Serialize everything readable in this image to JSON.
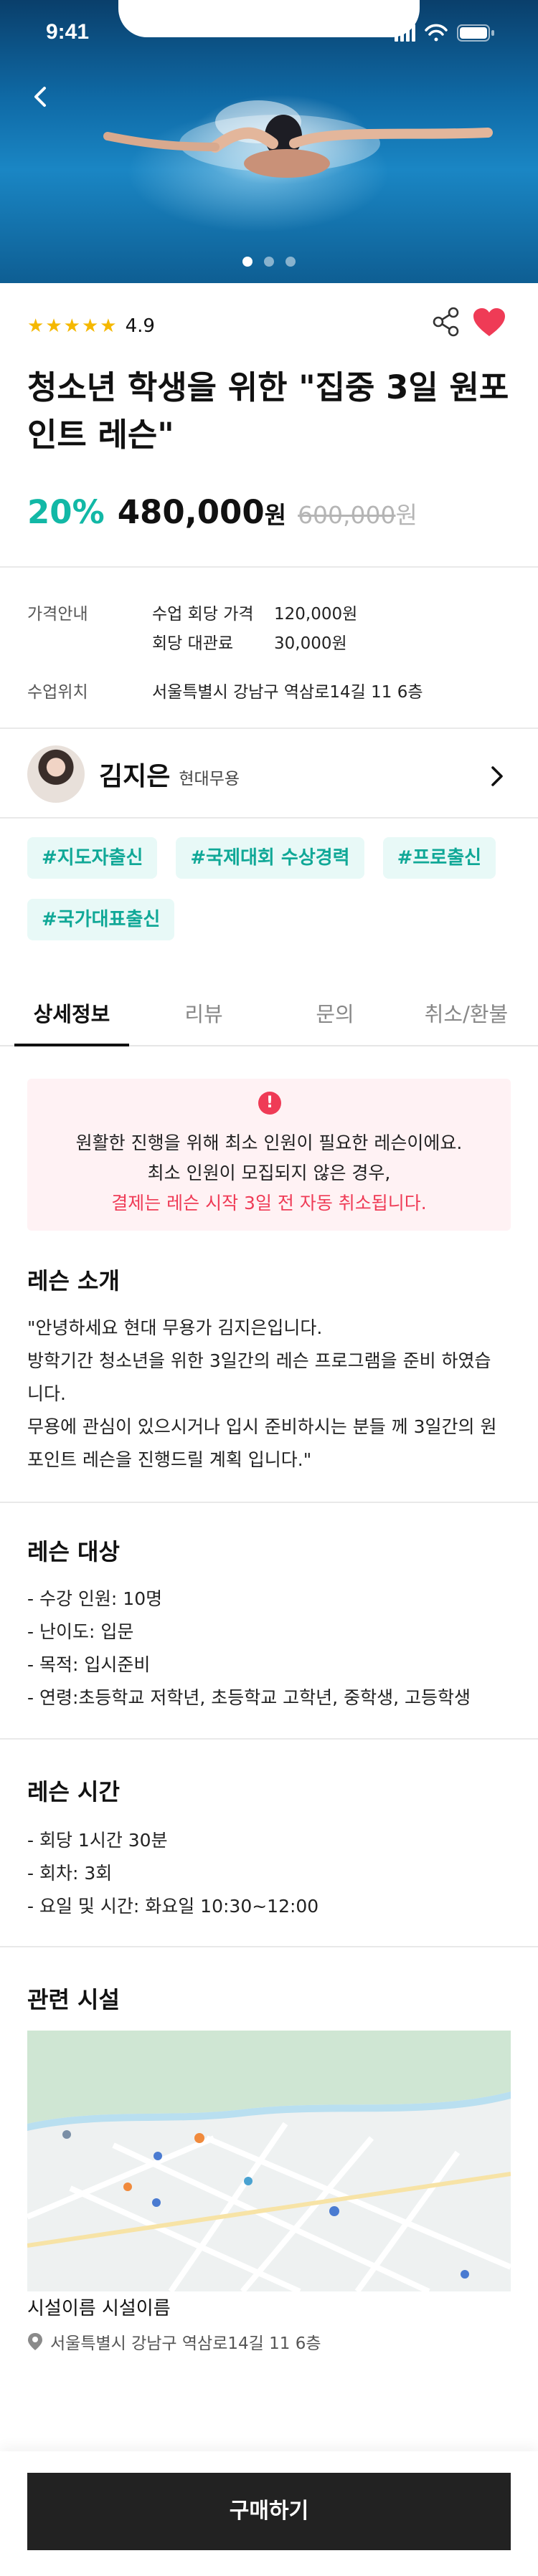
{
  "status": {
    "time": "9:41"
  },
  "hero": {
    "slides": 3,
    "active_slide": 1
  },
  "rating": {
    "stars": 5,
    "value": "4.9"
  },
  "title": "청소년 학생을 위한 \"집중 3일 원포인트 레슨\"",
  "price": {
    "discount": "20%",
    "price": "480,000",
    "unit": "원",
    "original": "600,000",
    "original_unit": "원"
  },
  "info": {
    "price_label": "가격안내",
    "fee_label": "수업 회당 가격",
    "fee_value": "120,000원",
    "rental_label": "회당 대관료",
    "rental_value": "30,000원",
    "location_label": "수업위치",
    "location_value": "서울특별시 강남구 역삼로14길 11 6층"
  },
  "instructor": {
    "name": "김지은",
    "genre": "현대무용"
  },
  "tags": [
    "#지도자출신",
    "#국제대회 수상경력",
    "#프로출신",
    "#국가대표출신"
  ],
  "tabs": [
    "상세정보",
    "리뷰",
    "문의",
    "취소/환불"
  ],
  "notice": {
    "line1": "원활한 진행을 위해 최소 인원이 필요한 레슨이에요.",
    "line2": "최소 인원이 모집되지 않은 경우,",
    "line3": "결제는 레슨 시작 3일 전 자동 취소됩니다."
  },
  "intro": {
    "title": "레슨 소개",
    "l1": "\"안녕하세요 현대 무용가 김지은입니다.",
    "l2": "방학기간 청소년을 위한 3일간의 레슨 프로그램을 준비 하였습",
    "l3": "니다.",
    "l4": "무용에 관심이 있으시거나 입시 준비하시는 분들 께 3일간의 원",
    "l5": "포인트 레슨을 진행드릴 계획 입니다.\""
  },
  "target": {
    "title": "레슨 대상",
    "l1": "- 수강 인원: 10명",
    "l2": "- 난이도: 입문",
    "l3": "- 목적: 입시준비",
    "l4": "- 연령:초등학교 저학년, 초등학교 고학년, 중학생, 고등학생"
  },
  "time": {
    "title": "레슨 시간",
    "l1": "- 회당 1시간 30분",
    "l2": "- 회차: 3회",
    "l3": "- 요일 및 시간: 화요일 10:30~12:00"
  },
  "facility": {
    "title": "관련 시설",
    "name": "시설이름 시설이름",
    "address": "서울특별시 강남구 역삼로14길 11 6층"
  },
  "buy_label": "구매하기",
  "colors": {
    "accent": "#12b8a6",
    "alert": "#ef3b56",
    "button": "#222222",
    "star": "#f5b800"
  }
}
